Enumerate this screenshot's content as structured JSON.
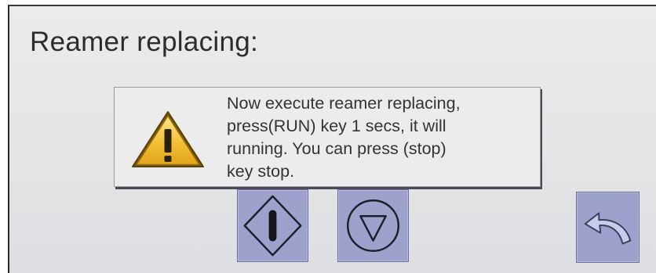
{
  "screen": {
    "title": "Reamer replacing:"
  },
  "dialog": {
    "icon": "warning-triangle-icon",
    "message_lines": [
      "Now execute reamer replacing,",
      "press(RUN) key 1 secs, it will",
      "running. You can press (stop)",
      "key stop."
    ]
  },
  "keys": [
    {
      "id": "run",
      "icon": "run-diamond-icon"
    },
    {
      "id": "stop",
      "icon": "stop-circle-triangle-icon"
    },
    {
      "id": "back",
      "icon": "back-arrow-icon"
    }
  ],
  "colors": {
    "key_fill": "#9ea1cc",
    "warning_yellow": "#f2c33a",
    "background": "#e6e7e8"
  }
}
